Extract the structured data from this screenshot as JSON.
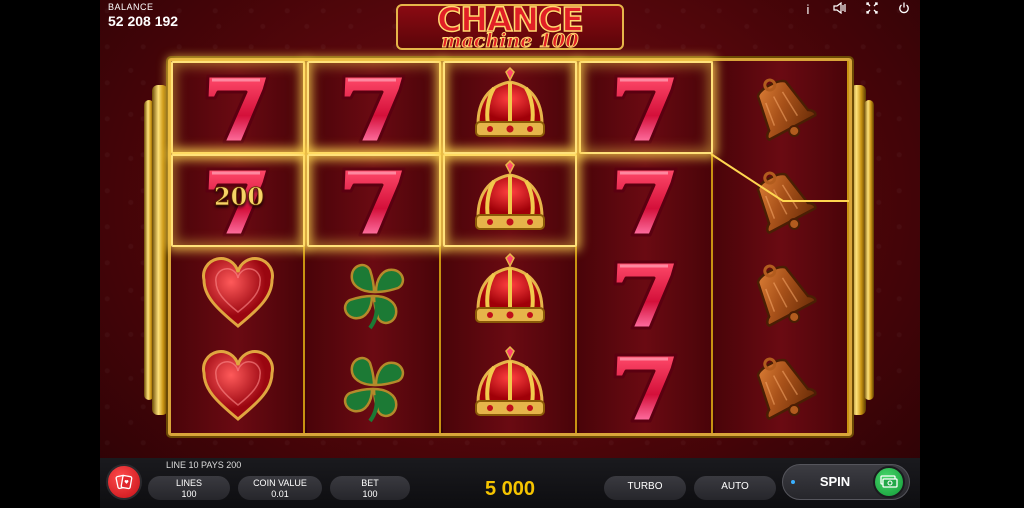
{
  "balance": {
    "label": "BALANCE",
    "value": "52 208 192"
  },
  "top_icons": [
    {
      "name": "info-icon",
      "glyph": "i"
    },
    {
      "name": "sound-icon",
      "glyph": "◁⦀"
    },
    {
      "name": "fullscreen-icon",
      "glyph": "⤡"
    },
    {
      "name": "power-icon",
      "glyph": "⏻"
    }
  ],
  "logo": {
    "title": "CHANCE",
    "subtitle": "machine 100"
  },
  "reels": [
    [
      "seven",
      "seven",
      "heart",
      "heart"
    ],
    [
      "seven",
      "seven",
      "clover",
      "clover"
    ],
    [
      "crown",
      "crown",
      "crown",
      "crown"
    ],
    [
      "seven",
      "seven",
      "seven",
      "seven"
    ],
    [
      "bell",
      "bell",
      "bell",
      "bell"
    ]
  ],
  "win_highlight": {
    "cells": [
      [
        0,
        0
      ],
      [
        1,
        0
      ],
      [
        3,
        0
      ],
      [
        0,
        1
      ],
      [
        1,
        1
      ],
      [
        2,
        1
      ],
      [
        2,
        0
      ]
    ],
    "pay_amount": "200",
    "line_color": "#ffd650"
  },
  "bottom": {
    "line_info": "LINE 10 PAYS 200",
    "lines_label": "LINES",
    "lines_value": "100",
    "coin_label": "COIN VALUE",
    "coin_value": "0.01",
    "bet_label": "BET",
    "bet_value": "100",
    "win_value": "5 000",
    "turbo_label": "TURBO",
    "auto_label": "AUTO",
    "spin_label": "SPIN"
  },
  "colors": {
    "accent_gold": "#d9a53a",
    "win_text": "#f5c400",
    "spin_green": "#2fbf55",
    "menu_red": "#e0262c"
  }
}
